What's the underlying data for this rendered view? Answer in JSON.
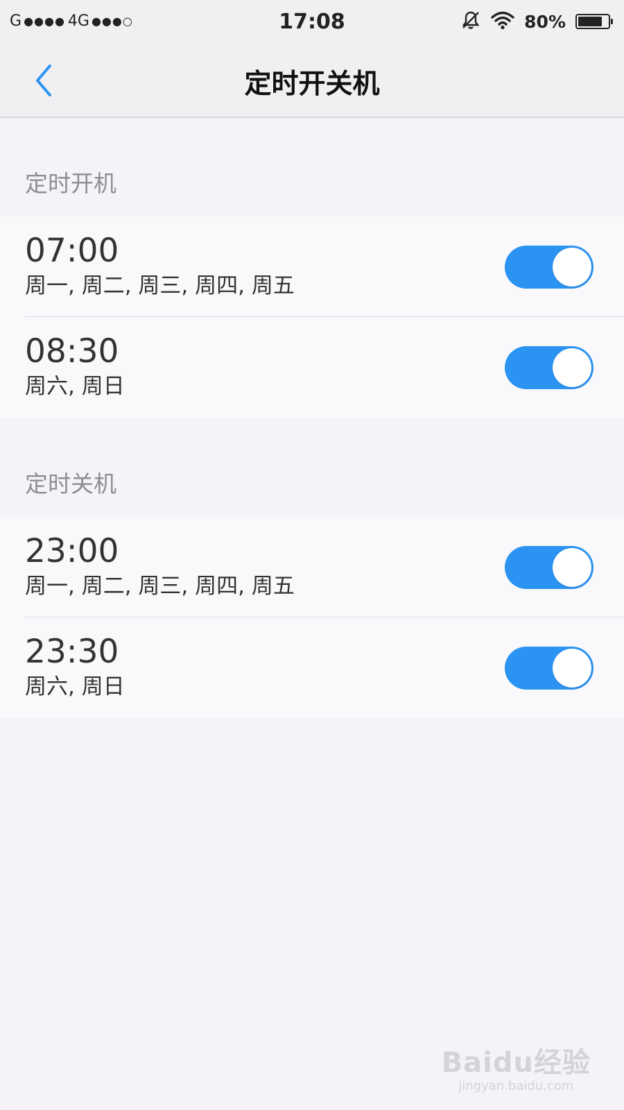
{
  "status_bar": {
    "carrier1": "G",
    "carrier1_dots": "●●●●",
    "network": "4G",
    "carrier2_dots": "●●●○",
    "time": "17:08",
    "battery_text": "80%",
    "battery_level": 0.8
  },
  "nav": {
    "title": "定时开关机",
    "back_icon": "chevron-left-icon"
  },
  "power_on": {
    "header": "定时开机",
    "schedules": [
      {
        "time": "07:00",
        "days": "周一, 周二, 周三, 周四, 周五",
        "enabled": true
      },
      {
        "time": "08:30",
        "days": "周六, 周日",
        "enabled": true
      }
    ]
  },
  "power_off": {
    "header": "定时关机",
    "schedules": [
      {
        "time": "23:00",
        "days": "周一, 周二, 周三, 周四, 周五",
        "enabled": true
      },
      {
        "time": "23:30",
        "days": "周六, 周日",
        "enabled": true
      }
    ]
  },
  "watermark": {
    "logo": "Baidu经验",
    "url": "jingyan.baidu.com"
  },
  "colors": {
    "accent": "#2b93f2",
    "background": "#f4f3f7",
    "header_text": "#8e8e93"
  }
}
